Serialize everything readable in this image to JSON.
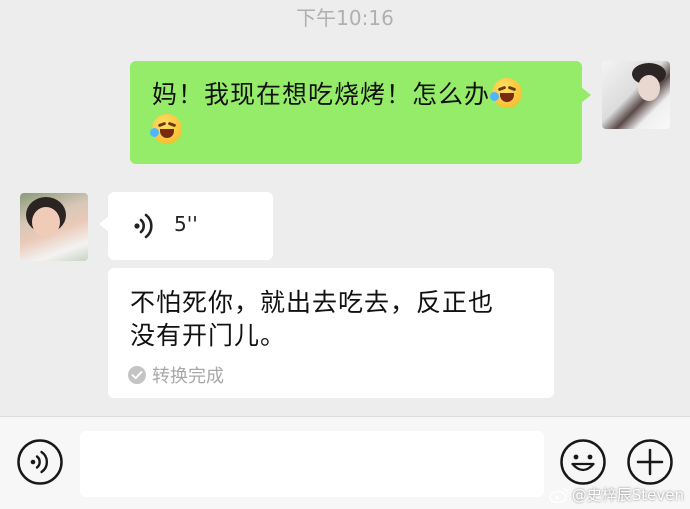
{
  "status": {
    "timestamp": "下午10:16"
  },
  "messages": {
    "outgoing": {
      "text": "妈！我现在想吃烧烤！怎么办"
    },
    "voice": {
      "duration": "5''"
    },
    "transcript": {
      "line1": "不怕死你，就出去吃去，反正也",
      "line2": "没有开门儿。",
      "status": "转换完成"
    }
  },
  "input": {
    "placeholder": ""
  },
  "watermark": {
    "text": "@史梓辰Steven"
  },
  "colors": {
    "outgoing_bubble": "#95ec69",
    "incoming_bubble": "#ffffff",
    "background": "#ededed"
  }
}
